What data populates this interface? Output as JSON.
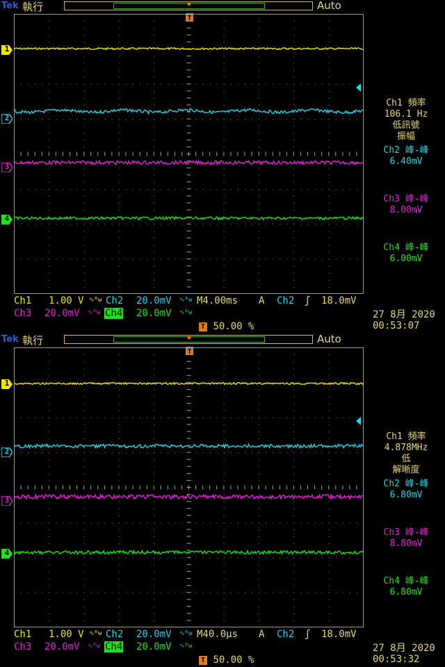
{
  "colors": {
    "ch1": "#f2e600",
    "ch2": "#27d3e6",
    "ch3": "#e321d8",
    "ch4": "#22e11f",
    "label": "#e6d77a",
    "trigger": "#e07a1a",
    "grid": "#8a8a8a"
  },
  "screens": [
    {
      "brand": "Tek",
      "run_state": "執行",
      "trigger_mode": "Auto",
      "measurements": {
        "ch1_label": "Ch1 頻率",
        "ch1_value": "106.1 Hz",
        "ch1_note1": "低訊號",
        "ch1_note2": "振幅",
        "ch2_label": "Ch2 峰-峰",
        "ch2_value": "6.40mV",
        "ch3_label": "Ch3 峰-峰",
        "ch3_value": "8.00mV",
        "ch4_label": "Ch4 峰-峰",
        "ch4_value": "6.00mV"
      },
      "status": {
        "ch1": "Ch1",
        "ch1_scale": "1.00 V",
        "ch2": "Ch2",
        "ch2_scale": "20.0mV",
        "ch3": "Ch3",
        "ch3_scale": "20.0mV",
        "ch4": "Ch4",
        "ch4_scale": "20.0mV",
        "bw_symbol": "∿ᴮw",
        "timebase": "M4.00ms",
        "acq": "A",
        "trigger_source": "Ch2",
        "trigger_slope": "ʃ",
        "trigger_level": "18.0mV",
        "trigger_position": "50.00 %",
        "date": "27 8月  2020",
        "time": "00:53:07"
      }
    },
    {
      "brand": "Tek",
      "run_state": "執行",
      "trigger_mode": "Auto",
      "measurements": {
        "ch1_label": "Ch1 頻率",
        "ch1_value": "4.878MHz",
        "ch1_note1": "低",
        "ch1_note2": "解晰度",
        "ch2_label": "Ch2 峰-峰",
        "ch2_value": "6.80mV",
        "ch3_label": "Ch3 峰-峰",
        "ch3_value": "8.80mV",
        "ch4_label": "Ch4 峰-峰",
        "ch4_value": "6.80mV"
      },
      "status": {
        "ch1": "Ch1",
        "ch1_scale": "1.00 V",
        "ch2": "Ch2",
        "ch2_scale": "20.0mV",
        "ch3": "Ch3",
        "ch3_scale": "20.0mV",
        "ch4": "Ch4",
        "ch4_scale": "20.0mV",
        "bw_symbol": "∿ᴮw",
        "timebase": "M40.0µs",
        "acq": "A",
        "trigger_source": "Ch2",
        "trigger_slope": "ʃ",
        "trigger_level": "18.0mV",
        "trigger_position": "50.00 %",
        "date": "27 8月  2020",
        "time": "00:53:32"
      }
    }
  ],
  "channel_markers": [
    "1",
    "2",
    "3",
    "4"
  ],
  "trigger_marker": "T"
}
